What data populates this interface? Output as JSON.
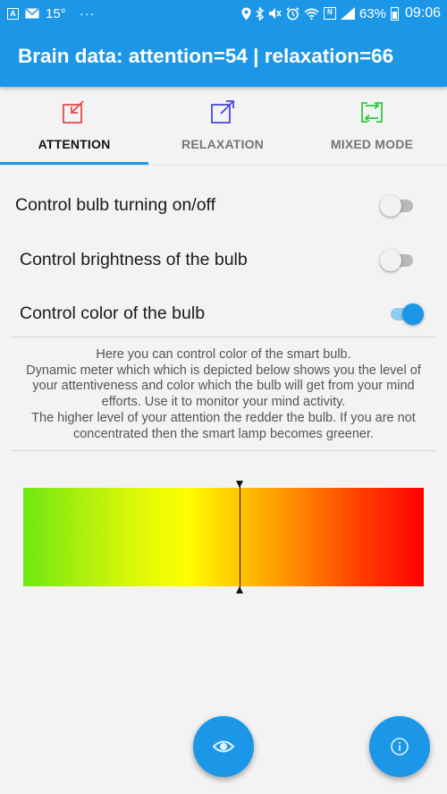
{
  "status_bar": {
    "temperature": "15°",
    "more": "···",
    "battery_percent": "63%",
    "time": "09:06",
    "icons": [
      "app-a-icon",
      "mail-icon",
      "location-icon",
      "bluetooth-icon",
      "mute-icon",
      "alarm-icon",
      "wifi-icon",
      "nfc-icon",
      "signal-icon",
      "battery-icon"
    ]
  },
  "app_bar": {
    "title": "Brain data: attention=54 | relaxation=66"
  },
  "tabs": [
    {
      "label": "ATTENTION",
      "icon": "arrow-in-icon",
      "color": "#e84a4a",
      "active": true
    },
    {
      "label": "RELAXATION",
      "icon": "arrow-out-icon",
      "color": "#4a4ad8",
      "active": false
    },
    {
      "label": "MIXED MODE",
      "icon": "swap-arrows-icon",
      "color": "#2ecc40",
      "active": false
    }
  ],
  "settings": [
    {
      "label": "Control bulb turning on/off",
      "enabled": false
    },
    {
      "label": "Control brightness of the bulb",
      "enabled": false
    },
    {
      "label": "Control color of the bulb",
      "enabled": true
    }
  ],
  "description": [
    "Here you can control color of the smart bulb.",
    "Dynamic meter which which is depicted below shows you the level of your attentiveness and color which the bulb will get from your mind efforts. Use it to monitor your mind activity.",
    "The higher level of your attention the redder the bulb. If you are not concentrated then the smart lamp becomes greener."
  ],
  "meter": {
    "level_percent": 54,
    "gradient_colors": [
      "#6fe812",
      "#ffff00",
      "#ff8a00",
      "#ff0000"
    ]
  },
  "fabs": [
    {
      "icon": "eye-icon"
    },
    {
      "icon": "info-icon"
    }
  ],
  "colors": {
    "primary": "#1c97e8",
    "background": "#f3f3f3"
  }
}
